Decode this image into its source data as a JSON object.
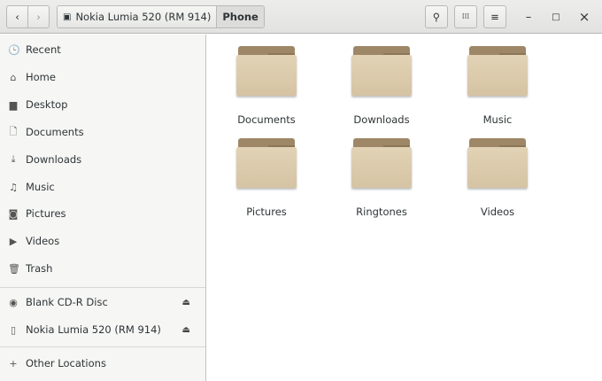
{
  "header": {
    "back_icon": "chevron-left",
    "forward_icon": "chevron-right",
    "breadcrumbs": [
      {
        "label": "Nokia Lumia 520 (RM 914)",
        "icon": "phone-icon"
      },
      {
        "label": "Phone"
      }
    ],
    "search_icon": "search",
    "view_icon": "grid",
    "menu_icon": "hamburger",
    "window": {
      "minimize": "–",
      "maximize": "□",
      "close": "×"
    }
  },
  "sidebar": {
    "items": [
      {
        "label": "Recent",
        "icon": "🕒"
      },
      {
        "label": "Home",
        "icon": "⌂"
      },
      {
        "label": "Desktop",
        "icon": "▆"
      },
      {
        "label": "Documents",
        "icon": "🗋"
      },
      {
        "label": "Downloads",
        "icon": "⤓"
      },
      {
        "label": "Music",
        "icon": "♫"
      },
      {
        "label": "Pictures",
        "icon": "◙"
      },
      {
        "label": "Videos",
        "icon": "▶"
      },
      {
        "label": "Trash",
        "icon": "🗑"
      }
    ],
    "devices": [
      {
        "label": "Blank CD-R Disc",
        "icon": "◉",
        "eject": "⏏"
      },
      {
        "label": "Nokia Lumia 520 (RM 914)",
        "icon": "▯",
        "eject": "⏏"
      }
    ],
    "other": {
      "label": "Other Locations",
      "icon": "+"
    }
  },
  "folders": [
    "Documents",
    "Downloads",
    "Music",
    "Pictures",
    "Ringtones",
    "Videos"
  ]
}
